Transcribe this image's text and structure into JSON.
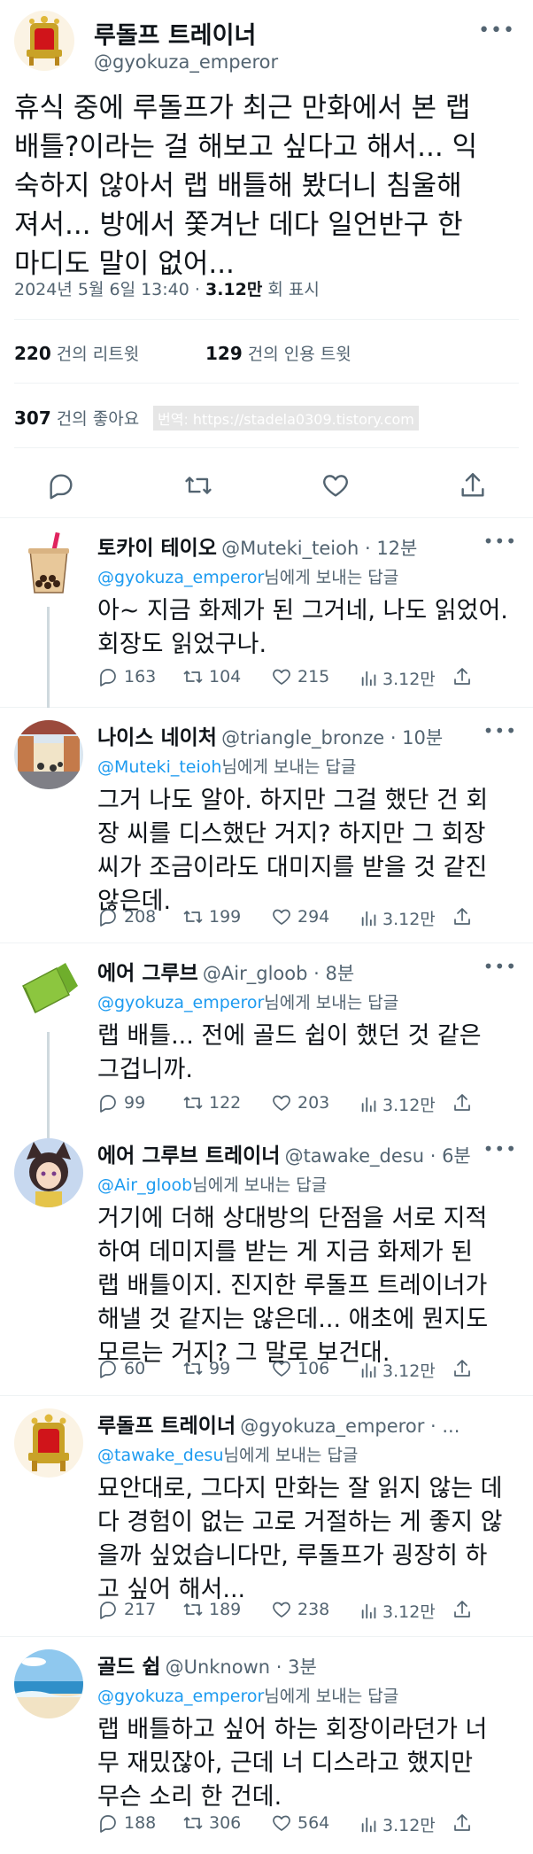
{
  "main": {
    "name": "루돌프 트레이너",
    "handle": "@gyokuza_emperor",
    "more": "•••",
    "text": "휴식 중에 루돌프가 최근 만화에서 본 랩\n배틀?이라는 걸 해보고 싶다고 해서... 익\n숙하지 않아서 랩 배틀해 봤더니 침울해\n져서... 방에서 쫓겨난 데다 일언반구 한\n마디도 말이 없어...",
    "date": "2024년 5월 6일  13:40 · ",
    "views": "3.12만",
    "views_label": " 회 표시",
    "retweets": "220",
    "retweets_label": "건의 리트윗",
    "quotes": "129",
    "quotes_label": "건의 인용 트윗",
    "likes": "307",
    "likes_label": "건의 좋아요",
    "watermark": "번역: https://stadela0309.tistory.com"
  },
  "replies": [
    {
      "name": "토카이 테이오",
      "handle": "@Muteki_teioh",
      "time": " · 12분",
      "replyto": "@gyokuza_emperor",
      "replyto_suffix": "님에게 보내는 답글",
      "text": "아~ 지금 화제가 된 그거네, 나도 읽었어.\n회장도 읽었구나.",
      "comments": "163",
      "retweets": "104",
      "likes": "215",
      "views": "3.12만",
      "more": "•••"
    },
    {
      "name": "나이스 네이처",
      "handle": "@triangle_bronze",
      "time": " · 10분",
      "replyto": "@Muteki_teioh",
      "replyto_suffix": "님에게 보내는 답글",
      "text": "그거 나도 알아. 하지만 그걸 했단 건 회\n장 씨를 디스했단 거지? 하지만 그 회장\n씨가 조금이라도 대미지를 받을 것 같진\n않은데.",
      "comments": "208",
      "retweets": "199",
      "likes": "294",
      "views": "3.12만",
      "more": "•••"
    },
    {
      "name": "에어 그루브",
      "handle": "@Air_gloob",
      "time": " · 8분",
      "replyto": "@gyokuza_emperor",
      "replyto_suffix": "님에게 보내는 답글",
      "text": "랩 배틀... 전에 골드 쉽이 했던 것 같은\n그겁니까.",
      "comments": "99",
      "retweets": "122",
      "likes": "203",
      "views": "3.12만",
      "more": "•••"
    },
    {
      "name": "에어 그루브 트레이너",
      "handle": "@tawake_desu",
      "time": " · 6분",
      "replyto": "@Air_gloob",
      "replyto_suffix": "님에게 보내는 답글",
      "text": "거기에 더해 상대방의 단점을 서로 지적\n하여 데미지를 받는 게 지금 화제가 된\n랩 배틀이지. 진지한 루돌프 트레이너가\n해낼 것 같지는 않은데... 애초에 뭔지도\n모르는 거지? 그 말로 보건대.",
      "comments": "60",
      "retweets": "99",
      "likes": "106",
      "views": "3.12만",
      "more": "•••"
    },
    {
      "name": "루돌프 트레이너",
      "handle": "@gyokuza_emperor",
      "time": " · ...",
      "replyto": "@tawake_desu",
      "replyto_suffix": "님에게 보내는 답글",
      "text": "묘안대로, 그다지 만화는 잘 읽지 않는 데\n다 경험이 없는 고로 거절하는 게 좋지 않\n을까 싶었습니다만, 루돌프가 굉장히 하\n고 싶어 해서...",
      "comments": "217",
      "retweets": "189",
      "likes": "238",
      "views": "3.12만",
      "more": "•••"
    },
    {
      "name": "골드 쉽",
      "handle": "@Unknown",
      "time": " · 3분",
      "replyto": "@gyokuza_emperor",
      "replyto_suffix": "님에게 보내는 답글",
      "text": "랩 배틀하고 싶어 하는 회장이라던가 너\n무 재밌잖아, 근데 너 디스라고 했지만\n무슨 소리 한 건데.",
      "comments": "188",
      "retweets": "306",
      "likes": "564",
      "views": "3.12만",
      "more": "•••"
    }
  ],
  "colors": {
    "accent": "#1d9bf0",
    "secondary": "#536471",
    "text": "#0f1419",
    "divider": "#eff3f4"
  }
}
